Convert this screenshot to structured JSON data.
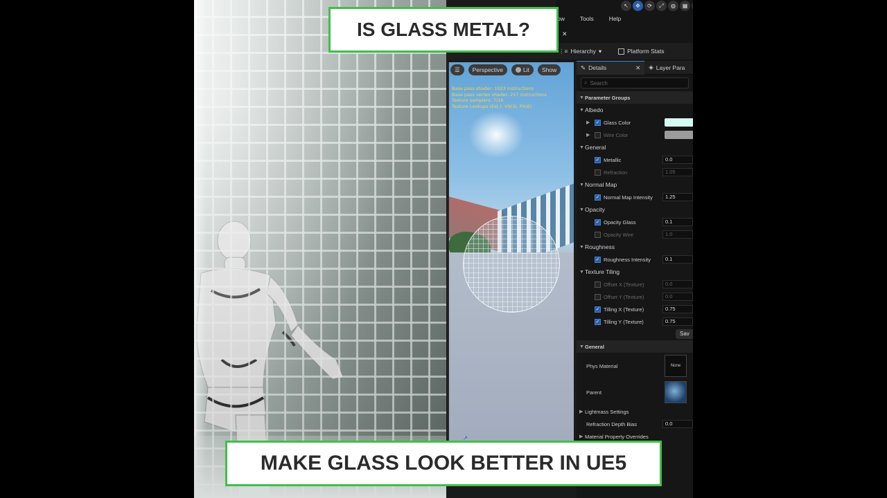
{
  "overlay": {
    "top_title": "IS GLASS METAL?",
    "bottom_title": "MAKE GLASS LOOK BETTER IN UE5"
  },
  "menu": {
    "items": [
      "ow",
      "Tools",
      "Help"
    ]
  },
  "window_toolbar": {
    "hierarchy_label": "Hierarchy",
    "platform_stats_label": "Platform Stats"
  },
  "viewport": {
    "perspective_label": "Perspective",
    "lit_label": "Lit",
    "show_label": "Show",
    "stats": [
      "Base pass shader: 1023 instructions",
      "Base pass vertex shader: 257 instructions",
      "Texture samplers: 7/16",
      "Texture Lookups (Est.): VS(3), PS(6)"
    ]
  },
  "details": {
    "tab_label": "Details",
    "second_tab_label": "Layer Para",
    "search_placeholder": "Search",
    "parameter_groups_label": "Parameter Groups",
    "albedo": {
      "label": "Albedo",
      "glass_color_label": "Glass Color",
      "glass_color": "#d6fbf3",
      "wire_color_label": "Wire Color",
      "wire_color": "#9c9c9c"
    },
    "general": {
      "label": "General",
      "metallic_label": "Metallic",
      "metallic_value": "0.0",
      "refraction_label": "Refraction",
      "refraction_value": "1.05"
    },
    "normal_map": {
      "label": "Normal Map",
      "intensity_label": "Normal Map Intensity",
      "intensity_value": "1.25"
    },
    "opacity": {
      "label": "Opacity",
      "glass_label": "Opacity Glass",
      "glass_value": "0.1",
      "wire_label": "Opacity Wire",
      "wire_value": "1.0"
    },
    "roughness": {
      "label": "Roughness",
      "intensity_label": "Roughness Intensity",
      "intensity_value": "0.1"
    },
    "texture_tiling": {
      "label": "Texture Tiling",
      "offset_x_label": "Offset X (Texture)",
      "offset_x_value": "0.0",
      "offset_y_label": "Offset Y (Texture)",
      "offset_y_value": "0.0",
      "tiling_x_label": "Tilling X (Texture)",
      "tiling_x_value": "0.75",
      "tiling_y_label": "Tilling Y (Texture)",
      "tiling_y_value": "0.75"
    },
    "save_label": "Sav",
    "general_section": {
      "label": "General",
      "phys_material_label": "Phys Material",
      "phys_material_value": "None",
      "parent_label": "Parent",
      "lightmass_label": "Lightmass Settings",
      "refraction_depth_bias_label": "Refraction Depth Bias",
      "refraction_depth_bias_value": "0.0",
      "overrides_label": "Material Property Overrides"
    }
  }
}
